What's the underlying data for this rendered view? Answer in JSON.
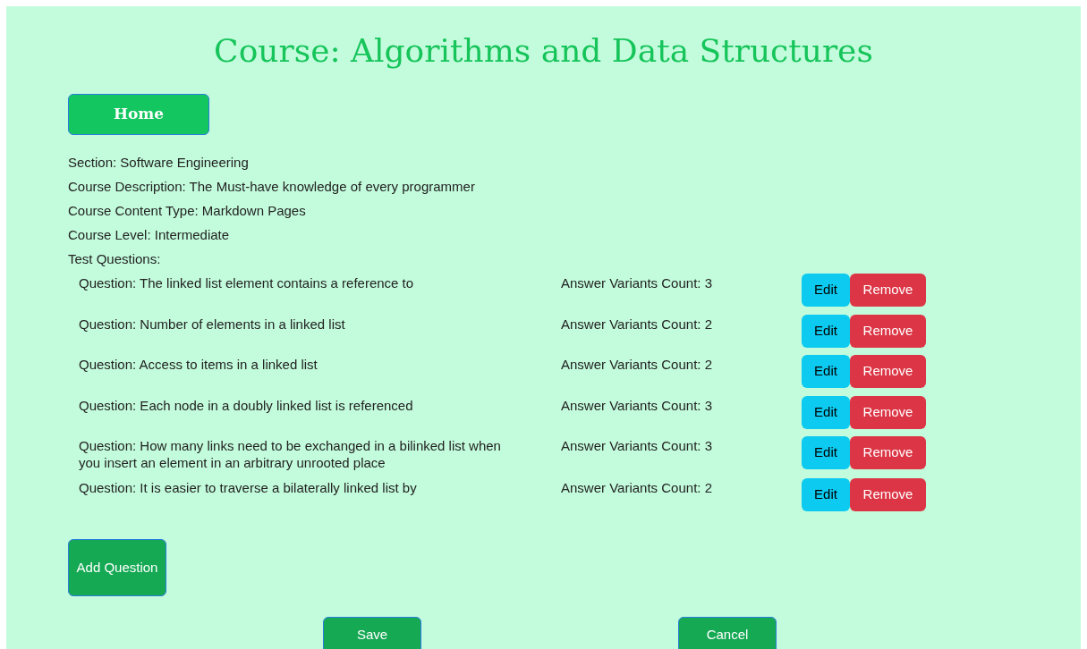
{
  "title": "Course: Algorithms and Data Structures",
  "home_button": "Home",
  "details": [
    "Section: Software Engineering",
    "Course Description: The Must-have knowledge of every programmer",
    "Course Content Type: Markdown Pages",
    "Course Level: Intermediate",
    "Test Questions:"
  ],
  "questions": [
    {
      "question": "Question: The linked list element contains a reference to",
      "count": "Answer Variants Count: 3",
      "edit": "Edit",
      "remove": "Remove"
    },
    {
      "question": "Question: Number of elements in a linked list",
      "count": "Answer Variants Count: 2",
      "edit": "Edit",
      "remove": "Remove"
    },
    {
      "question": "Question: Access to items in a linked list",
      "count": "Answer Variants Count: 2",
      "edit": "Edit",
      "remove": "Remove"
    },
    {
      "question": "Question: Each node in a doubly linked list is referenced",
      "count": "Answer Variants Count: 3",
      "edit": "Edit",
      "remove": "Remove"
    },
    {
      "question": "Question: How many links need to be exchanged in a bilinked list when you insert an element in an arbitrary unrooted place",
      "count": "Answer Variants Count: 3",
      "edit": "Edit",
      "remove": "Remove"
    },
    {
      "question": "Question: It is easier to traverse a bilaterally linked list by",
      "count": "Answer Variants Count: 2",
      "edit": "Edit",
      "remove": "Remove"
    }
  ],
  "add_button": "Add Question",
  "save_button": "Save",
  "cancel_button": "Cancel"
}
